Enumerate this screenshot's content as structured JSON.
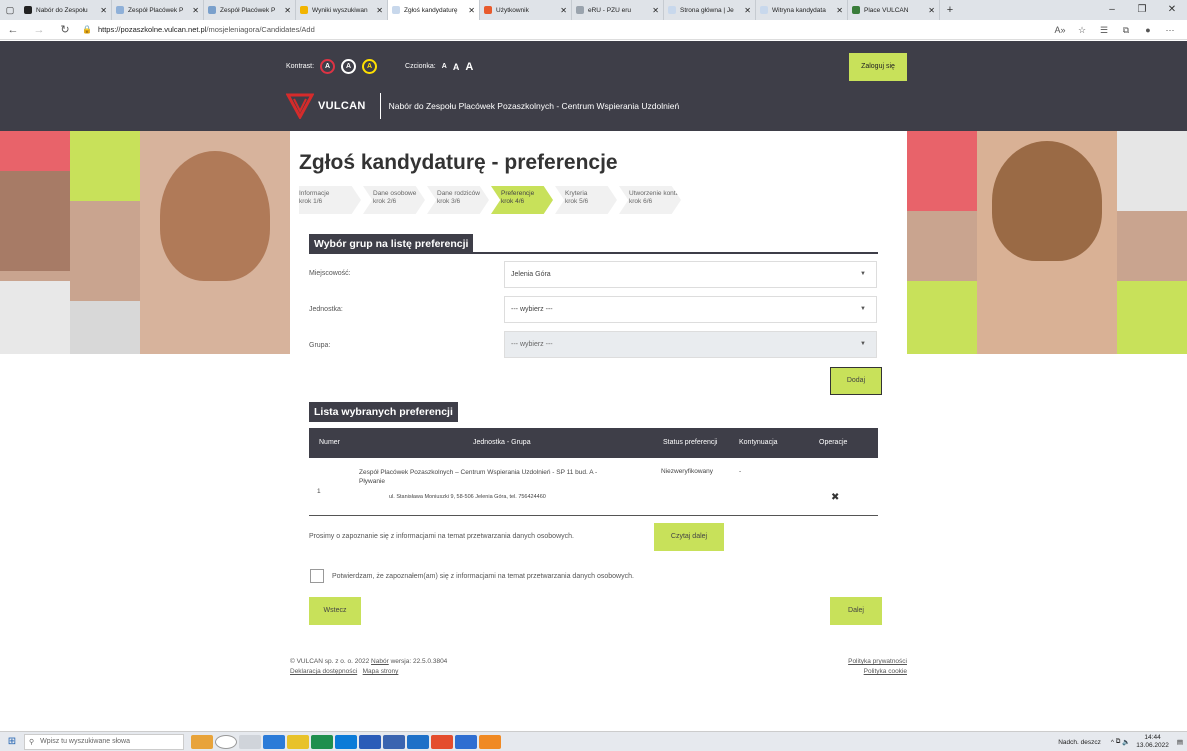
{
  "browser": {
    "tabs": [
      {
        "label": "Nabór do Zespołu",
        "color": "#222"
      },
      {
        "label": "Zespół Placówek P",
        "color": "#8fb0d8"
      },
      {
        "label": "Zespół Placówek P",
        "color": "#7aa0cc"
      },
      {
        "label": "Wyniki wyszukiwan",
        "color": "#f2b400"
      },
      {
        "label": "Zgłoś kandydaturę",
        "color": "#c8d8ec"
      },
      {
        "label": "Użytkownik",
        "color": "#e85a2c"
      },
      {
        "label": "eRU - PZU eru",
        "color": "#9aa3ad"
      },
      {
        "label": "Strona główna | Je",
        "color": "#c8d8ec"
      },
      {
        "label": "Witryna kandydata",
        "color": "#c8d8ec"
      },
      {
        "label": "Place VULCAN",
        "color": "#3a7d3a"
      }
    ],
    "active_tab": 4,
    "url_host": "https://pozaszkolne.vulcan.net.pl",
    "url_path": "/mosjeleniagora/Candidates/Add"
  },
  "header": {
    "contrast_label": "Kontrast:",
    "contrast_buttons": [
      "A",
      "A",
      "A"
    ],
    "font_label": "Czcionka:",
    "font_sizes": [
      "A",
      "A",
      "A"
    ],
    "login_label": "Zaloguj się",
    "logo_text": "VULCAN",
    "site_title": "Nabór do Zespołu Placówek Pozaszkolnych - Centrum Wspierania Uzdolnień"
  },
  "page": {
    "title": "Zgłoś kandydaturę - preferencje",
    "steps": [
      {
        "name": "Informacje",
        "num": "krok 1/6"
      },
      {
        "name": "Dane osobowe",
        "num": "krok 2/6"
      },
      {
        "name": "Dane rodziców",
        "num": "krok 3/6"
      },
      {
        "name": "Preferencje",
        "num": "krok 4/6"
      },
      {
        "name": "Kryteria",
        "num": "krok 5/6"
      },
      {
        "name": "Utworzenie konta",
        "num": "krok 6/6"
      }
    ],
    "active_step": 3
  },
  "group_select": {
    "section_title": "Wybór grup na listę preferencji",
    "city_label": "Miejscowość:",
    "city_value": "Jelenia Góra",
    "unit_label": "Jednostka:",
    "unit_value": "--- wybierz ---",
    "group_label": "Grupa:",
    "group_value": "--- wybierz ---",
    "add_button": "Dodaj"
  },
  "preferences": {
    "section_title": "Lista wybranych preferencji",
    "columns": {
      "number": "Numer",
      "unit_group": "Jednostka - Grupa",
      "status": "Status preferencji",
      "continuation": "Kontynuacja",
      "operations": "Operacje"
    },
    "rows": [
      {
        "number": "1",
        "unit_line1": "Zespół Placówek Pozaszkolnych – Centrum Wspierania Uzdolnień - SP 11 bud. A -",
        "unit_line2": "Pływanie",
        "address": "ul. Stanisława Moniuszki 9, 58-506 Jelenia Góra, tel. 756424460",
        "status": "Niezweryfikowany",
        "continuation": "-",
        "delete_icon": "✖"
      }
    ]
  },
  "consent": {
    "info_text": "Prosimy o zapoznanie się z informacjami na temat przetwarzania danych osobowych.",
    "read_more": "Czytaj dalej",
    "checkbox_label": "Potwierdzam, że zapoznałem(am) się z informacjami na temat przetwarzania danych osobowych."
  },
  "nav": {
    "back": "Wstecz",
    "next": "Dalej"
  },
  "footer": {
    "copyright_prefix": "© VULCAN sp. z o. o. 2022",
    "product": "Nabór",
    "version": "wersja: 22.5.0.3804",
    "accessibility": "Deklaracja dostępności",
    "sitemap": "Mapa strony",
    "privacy": "Polityka prywatności",
    "cookies": "Polityka cookie"
  },
  "taskbar": {
    "search_placeholder": "Wpisz tu wyszukiwane słowa",
    "weather": "Nadch. deszcz",
    "time": "14:44",
    "date": "13.06.2022"
  },
  "colors": {
    "dark": "#3e3e48",
    "accent_green": "#c8e15a",
    "accent_red": "#e8636a",
    "brand_red": "#d52b2b"
  }
}
